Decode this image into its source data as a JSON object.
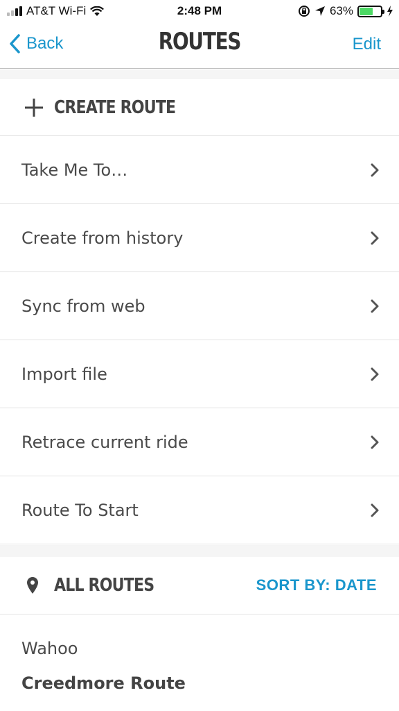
{
  "status_bar": {
    "carrier": "AT&T Wi-Fi",
    "time": "2:48 PM",
    "battery_percent": "63%",
    "battery_level": 0.63,
    "battery_color": "#4cd964"
  },
  "navbar": {
    "back_label": "Back",
    "title": "ROUTES",
    "edit_label": "Edit"
  },
  "create_route": {
    "label": "CREATE ROUTE",
    "icon": "plus-icon"
  },
  "menu": {
    "items": [
      {
        "label": "Take Me To…"
      },
      {
        "label": "Create from history"
      },
      {
        "label": "Sync from web"
      },
      {
        "label": "Import file"
      },
      {
        "label": "Retrace current ride"
      },
      {
        "label": "Route To Start"
      }
    ]
  },
  "all_routes": {
    "title": "ALL ROUTES",
    "icon": "location-pin-icon",
    "sort_label": "SORT BY: DATE"
  },
  "routes": {
    "group": "Wahoo",
    "first_route": "Creedmore Route"
  },
  "colors": {
    "accent": "#1a96cc",
    "text": "#444444"
  }
}
